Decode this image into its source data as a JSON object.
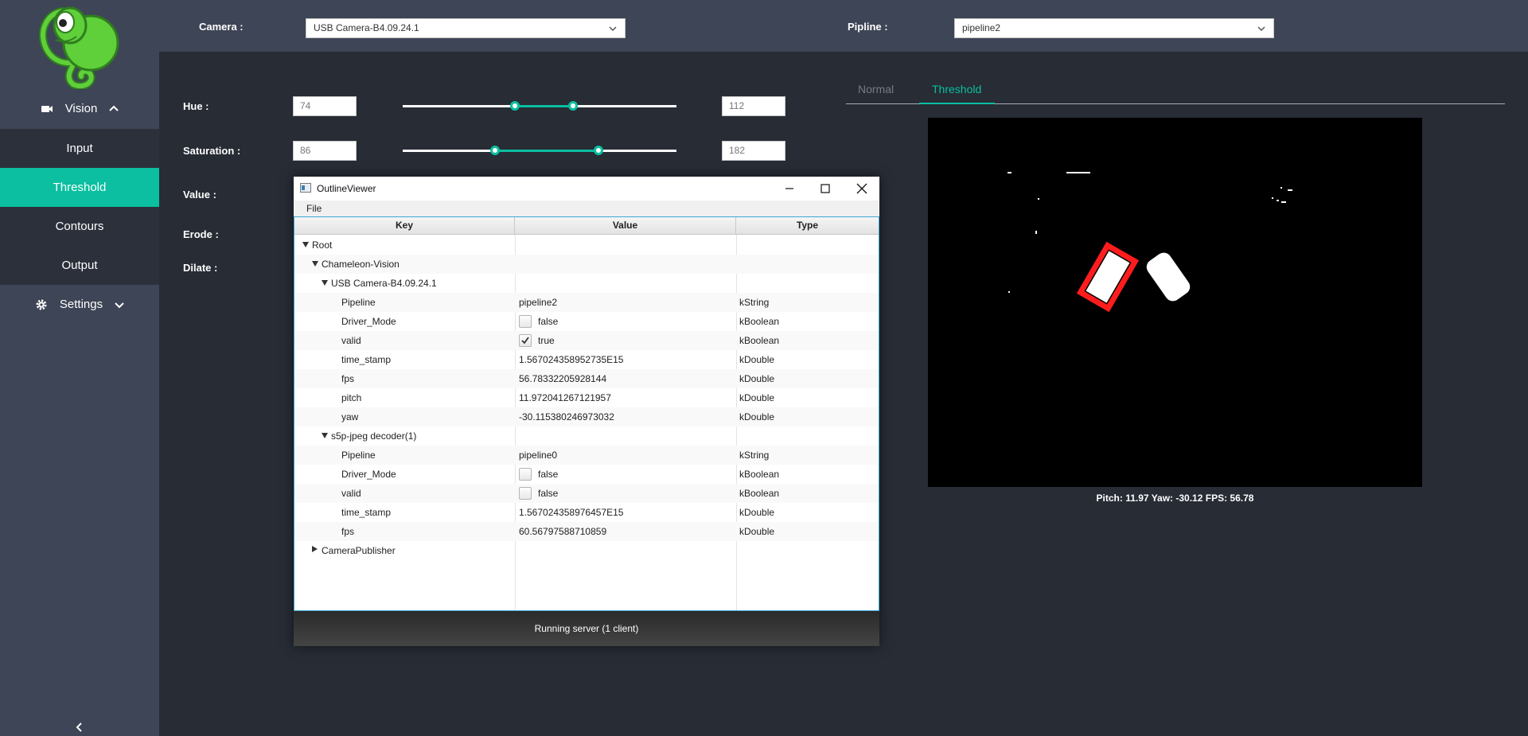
{
  "sidebar": {
    "vision_label": "Vision",
    "items": [
      {
        "label": "Input"
      },
      {
        "label": "Threshold"
      },
      {
        "label": "Contours"
      },
      {
        "label": "Output"
      }
    ],
    "settings_label": "Settings",
    "accent": "#0bbfa0"
  },
  "topbar": {
    "camera_label": "Camera :",
    "camera_value": "USB Camera-B4.09.24.1",
    "pipeline_label": "Pipline :",
    "pipeline_value": "pipeline2"
  },
  "params": {
    "hue": {
      "label": "Hue :",
      "min": "74",
      "max": "112",
      "range_min": 0,
      "range_max": 180
    },
    "saturation": {
      "label": "Saturation :",
      "min": "86",
      "max": "182",
      "range_min": 0,
      "range_max": 255
    },
    "value_label": "Value :",
    "erode_label": "Erode :",
    "dilate_label": "Dilate :"
  },
  "tabs": {
    "normal": "Normal",
    "threshold": "Threshold",
    "active": "threshold"
  },
  "status": "Pitch: 11.97 Yaw: -30.12 FPS: 56.78",
  "outline_viewer": {
    "title": "OutlineViewer",
    "menu_file": "File",
    "columns": {
      "key": "Key",
      "value": "Value",
      "type": "Type"
    },
    "rows": [
      {
        "key": "Root",
        "depth": 0,
        "expander": "open",
        "value": "",
        "type": ""
      },
      {
        "key": "Chameleon-Vision",
        "depth": 1,
        "expander": "open",
        "value": "",
        "type": ""
      },
      {
        "key": "USB Camera-B4.09.24.1",
        "depth": 2,
        "expander": "open",
        "value": "",
        "type": ""
      },
      {
        "key": "Pipeline",
        "depth": 3,
        "value": "pipeline2",
        "type": "kString"
      },
      {
        "key": "Driver_Mode",
        "depth": 3,
        "checkbox": false,
        "value": "false",
        "type": "kBoolean"
      },
      {
        "key": "valid",
        "depth": 3,
        "checkbox": true,
        "value": "true",
        "type": "kBoolean"
      },
      {
        "key": "time_stamp",
        "depth": 3,
        "value": "1.567024358952735E15",
        "type": "kDouble"
      },
      {
        "key": "fps",
        "depth": 3,
        "value": "56.78332205928144",
        "type": "kDouble"
      },
      {
        "key": "pitch",
        "depth": 3,
        "value": "11.972041267121957",
        "type": "kDouble"
      },
      {
        "key": "yaw",
        "depth": 3,
        "value": "-30.115380246973032",
        "type": "kDouble"
      },
      {
        "key": "s5p-jpeg decoder(1)",
        "depth": 2,
        "expander": "open",
        "value": "",
        "type": ""
      },
      {
        "key": "Pipeline",
        "depth": 3,
        "value": "pipeline0",
        "type": "kString"
      },
      {
        "key": "Driver_Mode",
        "depth": 3,
        "checkbox": false,
        "value": "false",
        "type": "kBoolean"
      },
      {
        "key": "valid",
        "depth": 3,
        "checkbox": false,
        "value": "false",
        "type": "kBoolean"
      },
      {
        "key": "time_stamp",
        "depth": 3,
        "value": "1.567024358976457E15",
        "type": "kDouble"
      },
      {
        "key": "fps",
        "depth": 3,
        "value": "60.56797588710859",
        "type": "kDouble"
      },
      {
        "key": "CameraPublisher",
        "depth": 1,
        "expander": "closed",
        "value": "",
        "type": ""
      }
    ],
    "footer": "Running server (1 client)"
  }
}
